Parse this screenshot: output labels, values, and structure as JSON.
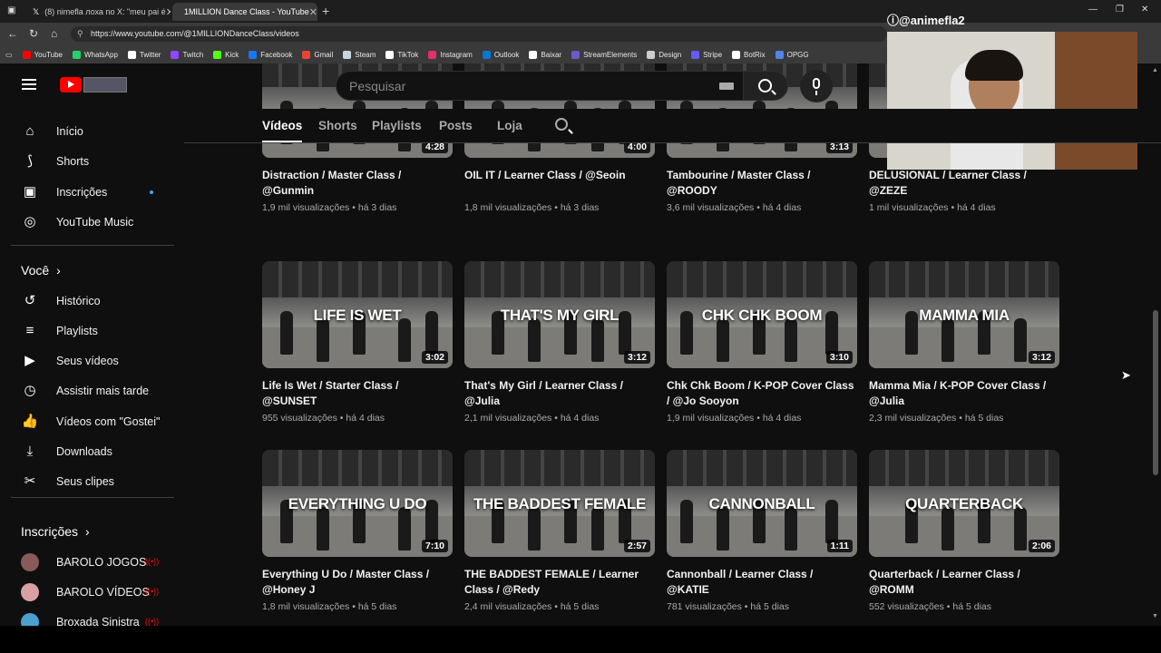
{
  "browser": {
    "tabs": [
      {
        "label": "(8) nimefla лоха no X: \"meu pai é",
        "icon": "x-icon"
      },
      {
        "label": "1MILLION Dance Class - YouTube",
        "icon": "youtube-icon",
        "active": true
      }
    ],
    "url": "https://www.youtube.com/@1MILLIONDanceClass/videos",
    "bookmarks": [
      {
        "label": "YouTube",
        "color": "#ff0000"
      },
      {
        "label": "WhatsApp",
        "color": "#25d366"
      },
      {
        "label": "Twitter",
        "color": "#ffffff"
      },
      {
        "label": "Twitch",
        "color": "#9146ff"
      },
      {
        "label": "Kick",
        "color": "#53fc18"
      },
      {
        "label": "Facebook",
        "color": "#1877f2"
      },
      {
        "label": "Gmail",
        "color": "#ea4335"
      },
      {
        "label": "Steam",
        "color": "#c7d5e0"
      },
      {
        "label": "TikTok",
        "color": "#ffffff"
      },
      {
        "label": "Instagram",
        "color": "#e1306c"
      },
      {
        "label": "Outlook",
        "color": "#0078d4"
      },
      {
        "label": "Baixar",
        "color": "#ffffff"
      },
      {
        "label": "StreamElements",
        "color": "#6a5acd"
      },
      {
        "label": "Design",
        "color": "#cccccc"
      },
      {
        "label": "Stripe",
        "color": "#635bff"
      },
      {
        "label": "BotRix",
        "color": "#ffffff"
      },
      {
        "label": "OPGG",
        "color": "#5383e8"
      }
    ]
  },
  "overlay": {
    "handle": "@animefla2"
  },
  "youtube": {
    "search_placeholder": "Pesquisar",
    "sidebar": {
      "main": [
        {
          "label": "Início",
          "icon": "home-icon"
        },
        {
          "label": "Shorts",
          "icon": "shorts-icon"
        },
        {
          "label": "Inscrições",
          "icon": "subscriptions-icon"
        },
        {
          "label": "YouTube Music",
          "icon": "youtube-music-icon"
        }
      ],
      "you_header": "Você",
      "you": [
        {
          "label": "Histórico",
          "icon": "history-icon"
        },
        {
          "label": "Playlists",
          "icon": "playlists-icon"
        },
        {
          "label": "Seus vídeos",
          "icon": "your-videos-icon"
        },
        {
          "label": "Assistir mais tarde",
          "icon": "watch-later-icon"
        },
        {
          "label": "Vídeos com \"Gostei\"",
          "icon": "liked-icon"
        },
        {
          "label": "Downloads",
          "icon": "download-icon"
        },
        {
          "label": "Seus clipes",
          "icon": "clips-icon"
        }
      ],
      "subs_header": "Inscrições",
      "subs": [
        {
          "label": "BAROLO JOGOS",
          "color": "#8a5a5a"
        },
        {
          "label": "BAROLO VÍDEOS",
          "color": "#d8a0a0"
        },
        {
          "label": "Broxada Sinistra",
          "color": "#4aa0d0"
        }
      ]
    },
    "channel_tabs": [
      "Vídeos",
      "Shorts",
      "Playlists",
      "Posts",
      "Loja"
    ],
    "videos": [
      {
        "thumb_text": "",
        "duration": "4:28",
        "title": "Distraction / Master Class / @Gunmin",
        "views": "1,9 mil visualizações",
        "age": "há 3 dias"
      },
      {
        "thumb_text": "",
        "duration": "4:00",
        "title": "OIL IT / Learner Class / @Seoin",
        "views": "1,8 mil visualizações",
        "age": "há 3 dias"
      },
      {
        "thumb_text": "",
        "duration": "3:13",
        "title": "Tambourine / Master Class / @ROODY",
        "views": "3,6 mil visualizações",
        "age": "há 4 dias"
      },
      {
        "thumb_text": "",
        "duration": "",
        "title": "DELUSIONAL / Learner Class / @ZEZE",
        "views": "1 mil visualizações",
        "age": "há 4 dias"
      },
      {
        "thumb_text": "LIFE IS WET",
        "duration": "3:02",
        "title": "Life Is Wet / Starter Class / @SUNSET",
        "views": "955 visualizações",
        "age": "há 4 dias"
      },
      {
        "thumb_text": "THAT'S MY GIRL",
        "duration": "3:12",
        "title": "That's My Girl / Learner Class / @Julia",
        "views": "2,1 mil visualizações",
        "age": "há 4 dias"
      },
      {
        "thumb_text": "CHK CHK BOOM",
        "duration": "3:10",
        "title": "Chk Chk Boom / K-POP Cover Class / @Jo Sooyon",
        "views": "1,9 mil visualizações",
        "age": "há 4 dias"
      },
      {
        "thumb_text": "MAMMA MIA",
        "duration": "3:12",
        "title": "Mamma Mia / K-POP Cover Class / @Julia",
        "views": "2,3 mil visualizações",
        "age": "há 5 dias"
      },
      {
        "thumb_text": "EVERYTHING U DO",
        "duration": "7:10",
        "title": "Everything U Do / Master Class / @Honey J",
        "views": "1,8 mil visualizações",
        "age": "há 5 dias"
      },
      {
        "thumb_text": "THE BADDEST FEMALE",
        "duration": "2:57",
        "title": "THE BADDEST FEMALE / Learner Class / @Redy",
        "views": "2,4 mil visualizações",
        "age": "há 5 dias"
      },
      {
        "thumb_text": "CANNONBALL",
        "duration": "1:11",
        "title": "Cannonball / Learner Class / @KATIE",
        "views": "781 visualizações",
        "age": "há 5 dias"
      },
      {
        "thumb_text": "QUARTERBACK",
        "duration": "2:06",
        "title": "Quarterback / Learner Class / @ROMM",
        "views": "552 visualizações",
        "age": "há 5 dias"
      }
    ]
  }
}
